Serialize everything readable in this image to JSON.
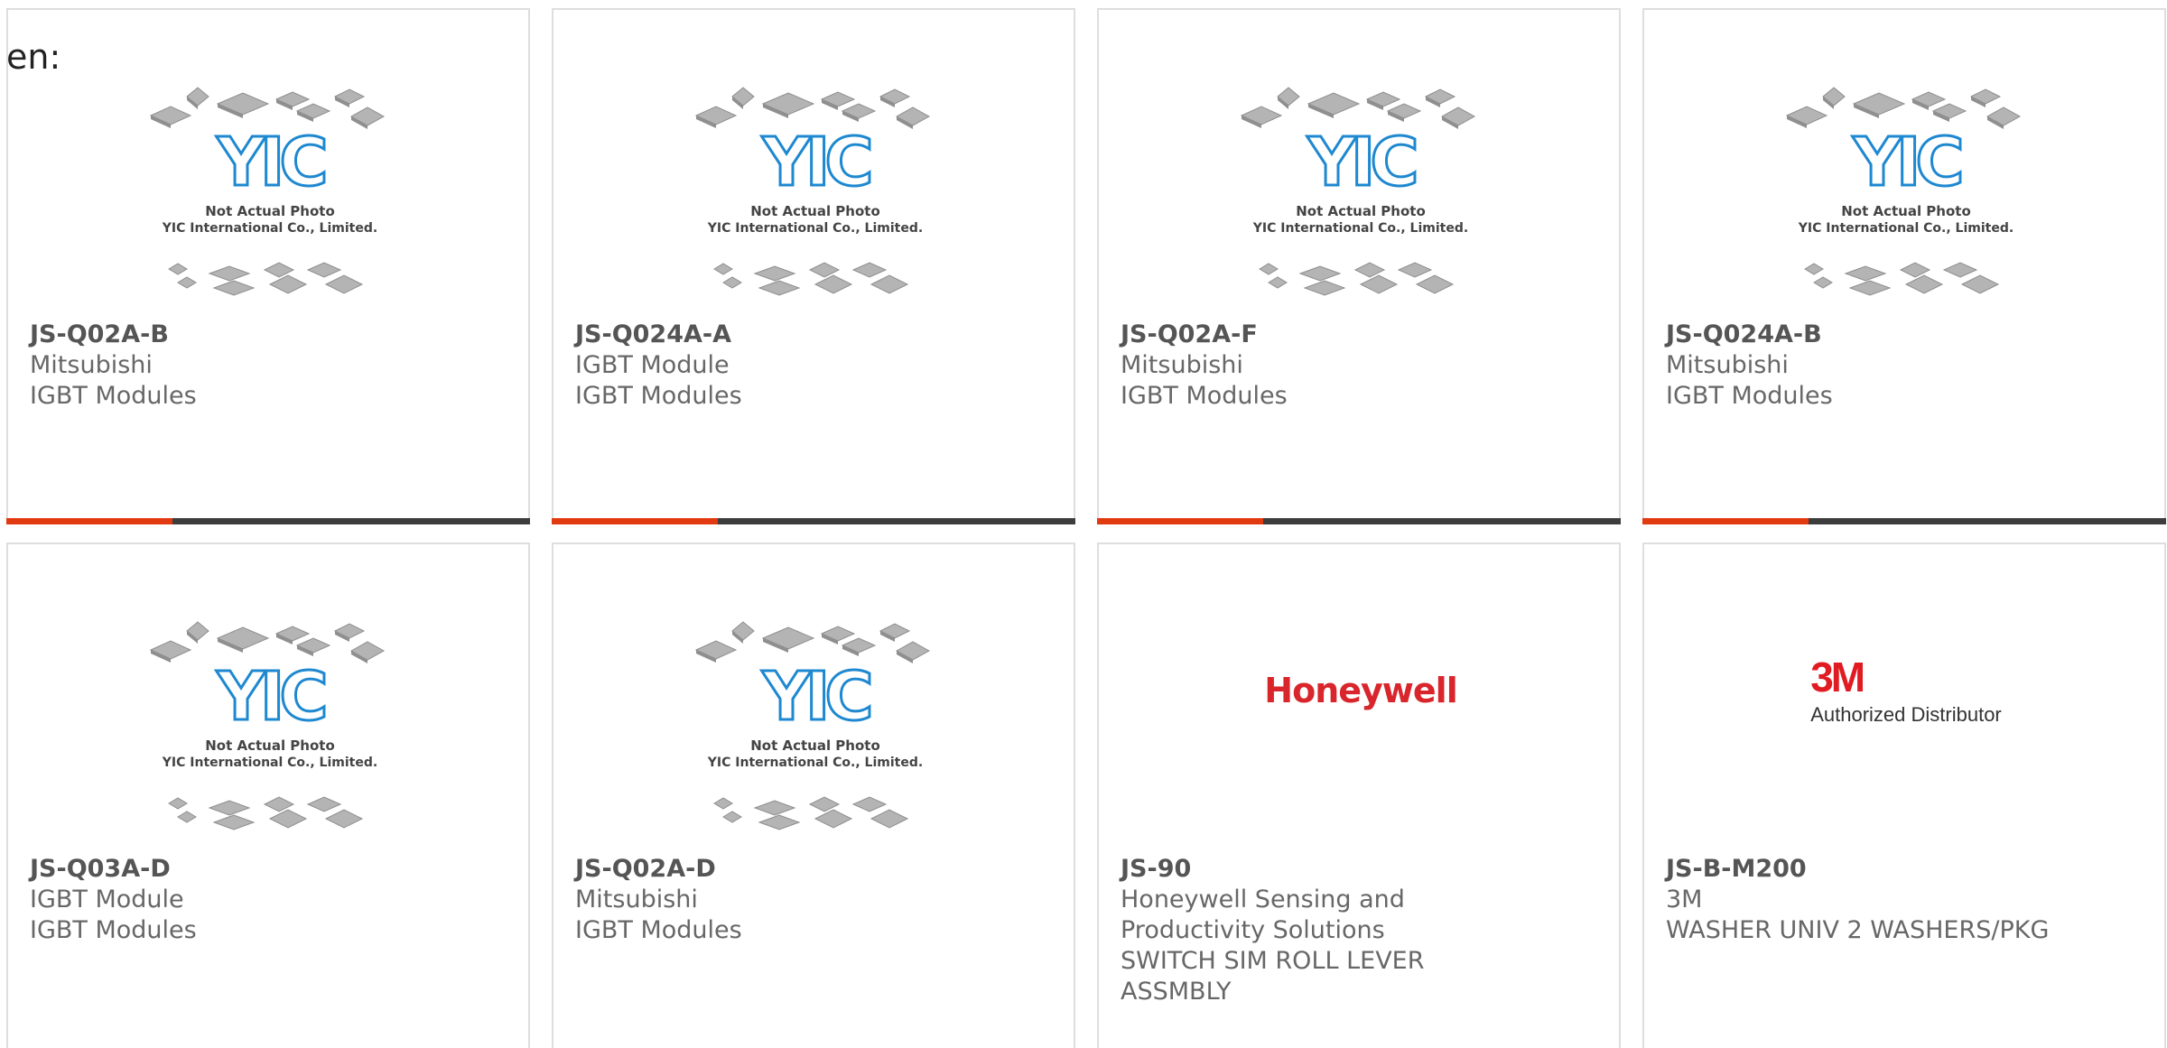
{
  "header": {
    "lang_label": "en:"
  },
  "placeholder": {
    "line1": "Not Actual Photo",
    "line2": "YIC International Co., Limited."
  },
  "colors": {
    "accent_bar": "#e23a10",
    "dark_bar": "#3d3d3d",
    "yic_blue": "#1e88d0",
    "honeywell_red": "#d8262c",
    "threem_red": "#e01b22"
  },
  "products": [
    {
      "part_number": "JS-Q02A-B",
      "lines": [
        "Mitsubishi",
        "IGBT Modules"
      ],
      "image": "yic-placeholder",
      "selected": true
    },
    {
      "part_number": "JS-Q024A-A",
      "lines": [
        "IGBT Module",
        "IGBT Modules"
      ],
      "image": "yic-placeholder",
      "selected": true
    },
    {
      "part_number": "JS-Q02A-F",
      "lines": [
        "Mitsubishi",
        "IGBT Modules"
      ],
      "image": "yic-placeholder",
      "selected": true
    },
    {
      "part_number": "JS-Q024A-B",
      "lines": [
        "Mitsubishi",
        "IGBT Modules"
      ],
      "image": "yic-placeholder",
      "selected": true
    },
    {
      "part_number": "JS-Q03A-D",
      "lines": [
        "IGBT Module",
        "IGBT Modules"
      ],
      "image": "yic-placeholder",
      "selected": false
    },
    {
      "part_number": "JS-Q02A-D",
      "lines": [
        "Mitsubishi",
        "IGBT Modules"
      ],
      "image": "yic-placeholder",
      "selected": false
    },
    {
      "part_number": "JS-90",
      "lines": [
        "Honeywell Sensing and",
        "Productivity Solutions",
        "SWITCH SIM ROLL LEVER",
        "ASSMBLY"
      ],
      "image": "honeywell-logo",
      "logo_text": "Honeywell",
      "selected": false
    },
    {
      "part_number": "JS-B-M200",
      "lines": [
        "3M",
        "WASHER UNIV 2 WASHERS/PKG"
      ],
      "image": "3m-logo",
      "logo_text": "3M",
      "logo_sub": "Authorized Distributor",
      "selected": false
    }
  ]
}
